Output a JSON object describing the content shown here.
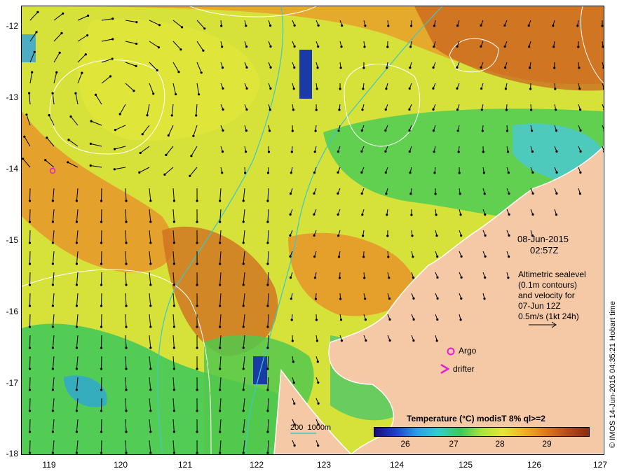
{
  "axes": {
    "y_ticks": [
      "-12",
      "-13",
      "-14",
      "-15",
      "-16",
      "-17",
      "-18"
    ],
    "x_ticks": [
      "119",
      "120",
      "121",
      "122",
      "123",
      "124",
      "125",
      "126",
      "127"
    ]
  },
  "annotation": {
    "date": "08-Jun-2015",
    "time": "02:57Z",
    "desc_lines": [
      "Altimetric sealevel",
      "(0.1m contours)",
      "and velocity for",
      "07-Jun 12Z",
      "0.5m/s (1kt 24h)"
    ]
  },
  "legend": {
    "argo_label": "Argo",
    "drifter_label": "drifter",
    "depth_label": "200  1000m"
  },
  "colorbar": {
    "title": "Temperature (°C) modisT 8% ql>=2",
    "ticks": [
      "26",
      "27",
      "28",
      "29"
    ],
    "colors": [
      "#1a0a7a",
      "#1f3fd0",
      "#2aa0e8",
      "#2ed0c8",
      "#3ac85a",
      "#a8e63a",
      "#e6e632",
      "#f0b020",
      "#e07818",
      "#b84a18",
      "#8a2a10"
    ]
  },
  "credit": "© IMOS 14-Jun-2015 04:35:21 Hobart time",
  "colors": {
    "land": "#f5c9a6",
    "warm": "#e69a28",
    "mid": "#c8e63c",
    "cool": "#3cc85a",
    "cold": "#1a3aa8",
    "argo": "#e020d0"
  }
}
